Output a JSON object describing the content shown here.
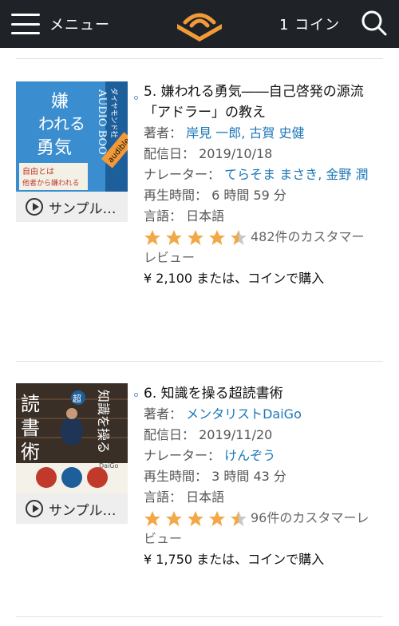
{
  "header": {
    "menu_label": "メニュー",
    "coin_label": "1 コイン",
    "logo_icon": "audible-logo-icon",
    "search_icon": "search-icon",
    "colors": {
      "bar": "#1f2328",
      "logo": "#f29a38"
    }
  },
  "items": [
    {
      "title": "5. 嫌われる勇気――自己啓発の源流「アドラー」の教え",
      "author_label": "著者：",
      "authors": "岸見 一郎, 古賀 史健",
      "release_label": "配信日：",
      "release_date": "2019/10/18",
      "narrator_label": "ナレーター：",
      "narrators": "てらそま まさき, 金野 潤",
      "length_label": "再生時間：",
      "length": "6 時間 59 分",
      "language_label": "言語：",
      "language": "日本語",
      "rating": 4.5,
      "reviews": "482件のカスタマーレビュー",
      "price": "¥ 2,100 または、コインで購入",
      "sample_label": "サンプル…",
      "cover": {
        "title": "嫌われる勇気",
        "publisher": "ダイヤモンド社",
        "series": "AUDIO BOOK",
        "quote": "自由とは他者から嫌われることである。",
        "badge": "audible"
      }
    },
    {
      "title": "6. 知識を操る超読書術",
      "author_label": "著者：",
      "authors": "メンタリストDaiGo",
      "release_label": "配信日：",
      "release_date": "2019/11/20",
      "narrator_label": "ナレーター：",
      "narrators": "けんぞう",
      "length_label": "再生時間：",
      "length": "3 時間 43 分",
      "language_label": "言語：",
      "language": "日本語",
      "rating": 4.5,
      "reviews": "96件のカスタマーレビュー",
      "price": "¥ 1,750 または、コインで購入",
      "sample_label": "サンプル…",
      "cover": {
        "title_left": "読書術",
        "title_right": "知識を操る",
        "super": "超",
        "author": "DaiGo"
      }
    }
  ]
}
